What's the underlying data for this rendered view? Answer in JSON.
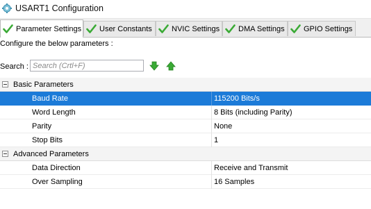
{
  "window": {
    "title": "USART1 Configuration"
  },
  "tabs": [
    {
      "label": "Parameter Settings"
    },
    {
      "label": "User Constants"
    },
    {
      "label": "NVIC Settings"
    },
    {
      "label": "DMA Settings"
    },
    {
      "label": "GPIO Settings"
    }
  ],
  "panel": {
    "instruction": "Configure the below parameters :"
  },
  "search": {
    "label": "Search :",
    "placeholder": "Search (Crtl+F)"
  },
  "groups": {
    "basic": {
      "label": "Basic Parameters",
      "rows": [
        {
          "name": "Baud Rate",
          "value": "115200 Bits/s"
        },
        {
          "name": "Word Length",
          "value": "8 Bits (including Parity)"
        },
        {
          "name": "Parity",
          "value": "None"
        },
        {
          "name": "Stop Bits",
          "value": "1"
        }
      ]
    },
    "advanced": {
      "label": "Advanced Parameters",
      "rows": [
        {
          "name": "Data Direction",
          "value": "Receive and Transmit"
        },
        {
          "name": "Over Sampling",
          "value": "16 Samples"
        }
      ]
    }
  },
  "colors": {
    "selection": "#1c7bd8",
    "check_icon": "#3aaa35",
    "arrow_icon": "#3aaa35"
  },
  "icons": {
    "title": "gear-icon",
    "tab": "checkmark-icon",
    "search_down": "arrow-down-icon",
    "search_up": "arrow-up-icon",
    "group": "collapse-icon"
  }
}
